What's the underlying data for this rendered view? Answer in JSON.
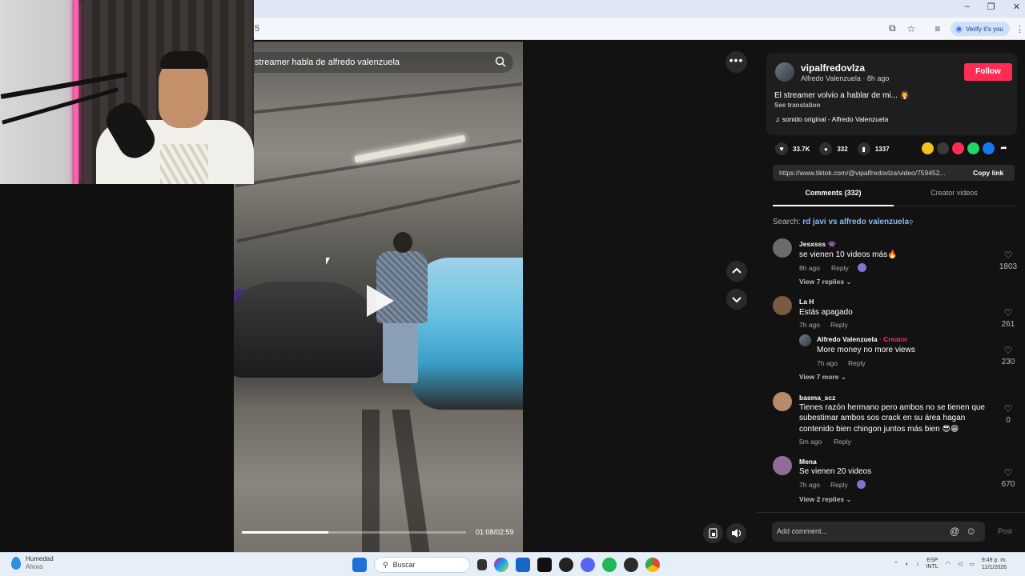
{
  "browser": {
    "url_fragment": "5",
    "verify_label": "Verify it's you"
  },
  "video": {
    "search_query": "streamer habla de alfredo valenzuela",
    "progress_fraction": 0.385,
    "time_label": "01:08/02:59"
  },
  "post": {
    "username": "vipalfredovlza",
    "display_line": "Alfredo Valenzuela · 8h ago",
    "follow_label": "Follow",
    "caption": "El streamer volvio a hablar de mi... 🧛",
    "see_translation": "See translation",
    "music": "sonido original - Alfredo Valenzuela",
    "likes": "33.7K",
    "comments": "332",
    "saves": "1337",
    "link": "https://www.tiktok.com/@vipalfredovlza/video/759452...",
    "copy_link_label": "Copy link"
  },
  "tabs": {
    "comments": "Comments (332)",
    "creator": "Creator videos"
  },
  "search_hint": {
    "prefix": "Search: ",
    "query": "rd javi vs alfredo valenzuela"
  },
  "comments": [
    {
      "name": "Jesxsss 👾",
      "text": "se vienen 10 videos más🔥",
      "time": "8h ago",
      "reply": "Reply",
      "likes": "1803",
      "view_replies": "View 7 replies ⌄"
    },
    {
      "name": "La H",
      "text": "Estás apagado",
      "time": "7h ago",
      "reply": "Reply",
      "likes": "261"
    },
    {
      "name": "Alfredo Valenzuela",
      "creator_tag": " · Creator",
      "text": "More money no more views",
      "time": "7h ago",
      "reply": "Reply",
      "likes": "230",
      "view_replies": "View 7 more ⌄"
    },
    {
      "name": "basma_scz",
      "text_lines": [
        "Tienes razón hermano pero ambos no se tienen que",
        "subestimar ambos sos crack en su área hagan",
        "contenido bien chingon juntos más bien 😎😁"
      ],
      "time": "5m ago",
      "reply": "Reply",
      "likes": "0"
    },
    {
      "name": "Mena",
      "text": "Se vienen 20 videos",
      "time": "7h ago",
      "reply": "Reply",
      "likes": "670",
      "view_replies": "View 2 replies ⌄"
    }
  ],
  "composer": {
    "placeholder": "Add comment...",
    "post_label": "Post"
  },
  "taskbar": {
    "weather_title": "Humedad",
    "weather_sub": "Ahora",
    "search_label": "Buscar",
    "lang_top": "ESP",
    "lang_bottom": "INTL",
    "time": "9:49 p. m.",
    "date": "12/1/2026"
  },
  "colors": {
    "follow": "#fe2c55",
    "accent_link": "#8bb7f5",
    "panel_bg": "#121212"
  }
}
